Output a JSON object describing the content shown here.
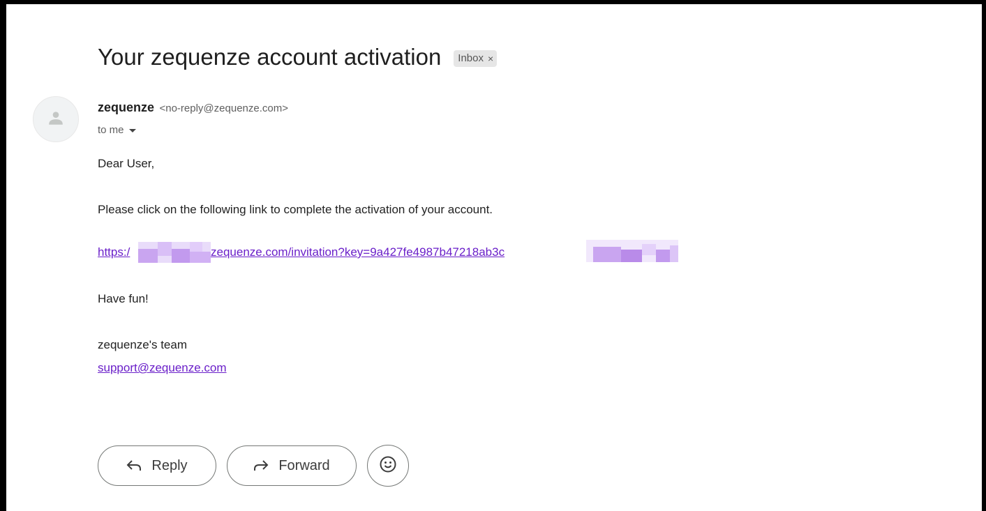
{
  "email": {
    "subject": "Your zequenze account activation",
    "label": "Inbox",
    "label_remove": "×",
    "sender_name": "zequenze",
    "sender_email": "<no-reply@zequenze.com>",
    "recipient": "to me",
    "body": {
      "greeting": "Dear User,",
      "instruction": "Please click on the following link to complete the activation of your account.",
      "link_prefix": "https:/",
      "link_visible": "zequenze.com/invitation?key=9a427fe4987b47218ab3c",
      "closing": "Have fun!",
      "signature": "zequenze's team",
      "support_email": "support@zequenze.com"
    }
  },
  "actions": {
    "reply_label": "Reply",
    "forward_label": "Forward"
  },
  "icons": {
    "avatar": "person-icon",
    "reply": "reply-arrow-icon",
    "forward": "forward-arrow-icon",
    "emoji": "smiley-icon",
    "recipient_details": "caret-down-icon"
  },
  "colors": {
    "link": "#6a1fc9",
    "redaction": "#c9a5f0",
    "label_chip": "#e6e6e6"
  }
}
